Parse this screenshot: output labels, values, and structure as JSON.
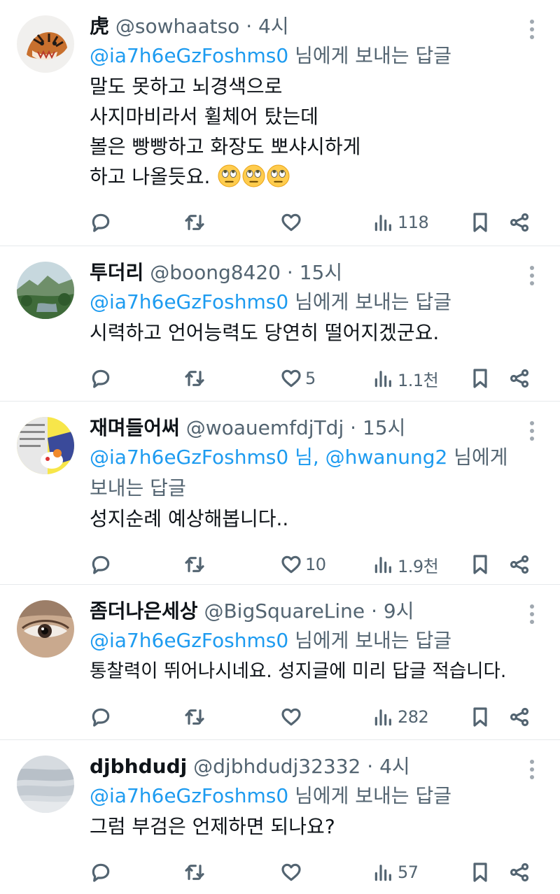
{
  "tweets": [
    {
      "name": "虎",
      "handle": "@sowhaatso",
      "sep": "·",
      "time": "4시",
      "reply_mentions": [
        "@ia7h6eGzFoshms0"
      ],
      "reply_suffix": "님에게 보내는 답글",
      "body_lines": [
        "말도 못하고 뇌경색으로",
        "사지마비라서 휠체어 탔는데",
        "볼은 빵빵하고 화장도 뽀샤시하게",
        "하고 나올듯요."
      ],
      "emojis": [
        "eye-roll-emoji",
        "eye-roll-emoji",
        "eye-roll-emoji"
      ],
      "replies": "",
      "retweets": "",
      "likes": "",
      "views": "118"
    },
    {
      "name": "투더리",
      "handle": "@boong8420",
      "sep": "·",
      "time": "15시",
      "reply_mentions": [
        "@ia7h6eGzFoshms0"
      ],
      "reply_suffix": "님에게 보내는 답글",
      "body_lines": [
        "시력하고 언어능력도 당연히 떨어지겠군요."
      ],
      "emojis": [],
      "replies": "",
      "retweets": "",
      "likes": "5",
      "views": "1.1천"
    },
    {
      "name": "재며들어써",
      "handle": "@woauemfdjTdj",
      "sep": "·",
      "time": "15시",
      "reply_mentions": [
        "@ia7h6eGzFoshms0 님,",
        "@hwanung2"
      ],
      "reply_suffix": "님에게 보내는 답글",
      "body_lines": [
        "성지순례 예상해봅니다.."
      ],
      "emojis": [],
      "replies": "",
      "retweets": "",
      "likes": "10",
      "views": "1.9천"
    },
    {
      "name": "좀더나은세상",
      "handle": "@BigSquareLine",
      "sep": "·",
      "time": "9시",
      "reply_mentions": [
        "@ia7h6eGzFoshms0"
      ],
      "reply_suffix": "님에게 보내는 답글",
      "body_lines": [
        "통찰력이 뛰어나시네요. 성지글에 미리 답글 적습니다."
      ],
      "emojis": [],
      "replies": "",
      "retweets": "",
      "likes": "",
      "views": "282"
    },
    {
      "name": "djbhdudj",
      "handle": "@djbhdudj32332",
      "sep": "·",
      "time": "4시",
      "reply_mentions": [
        "@ia7h6eGzFoshms0"
      ],
      "reply_suffix": "님에게 보내는 답글",
      "body_lines": [
        "그럼 부검은 언제하면 되나요?"
      ],
      "emojis": [],
      "replies": "",
      "retweets": "",
      "likes": "",
      "views": "57"
    }
  ],
  "icons": {
    "reply": "reply-icon",
    "retweet": "retweet-icon",
    "like": "heart-icon",
    "views": "views-icon",
    "bookmark": "bookmark-icon",
    "share": "share-icon",
    "more": "more-vertical-icon"
  },
  "colors": {
    "text": "#0f1419",
    "secondary": "#536471",
    "mention": "#1d9bf0",
    "divider": "#e6e9ec"
  }
}
